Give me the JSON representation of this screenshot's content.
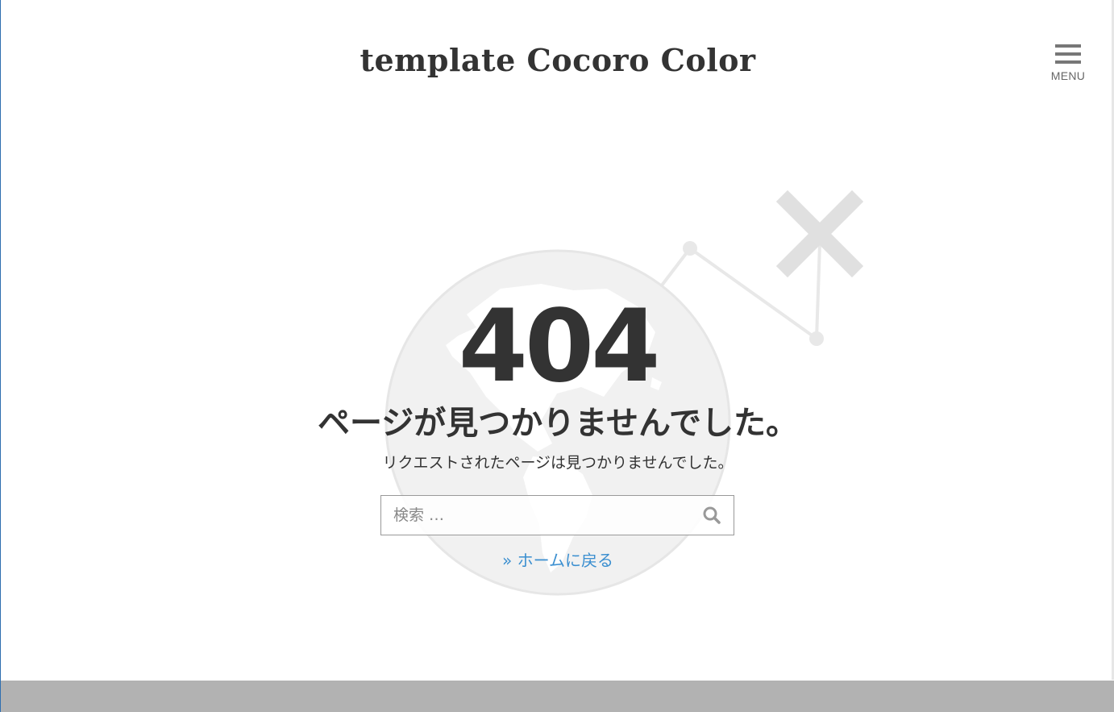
{
  "header": {
    "site_title": "template Cocoro Color",
    "menu_label": "MENU"
  },
  "error": {
    "code": "404",
    "heading": "ページが見つかりませんでした。",
    "message": "リクエストされたページは見つかりませんでした。"
  },
  "search": {
    "placeholder": "検索 …",
    "value": ""
  },
  "home_link": {
    "label": "» ホームに戻る"
  },
  "colors": {
    "accent_link": "#3b8fd0",
    "text": "#333333",
    "footer": "#b2b2b2",
    "illustration": "#e6e6e6"
  },
  "icons": {
    "menu": "hamburger-icon",
    "search": "magnifier-icon",
    "illustration": "broken-globe-icon"
  }
}
